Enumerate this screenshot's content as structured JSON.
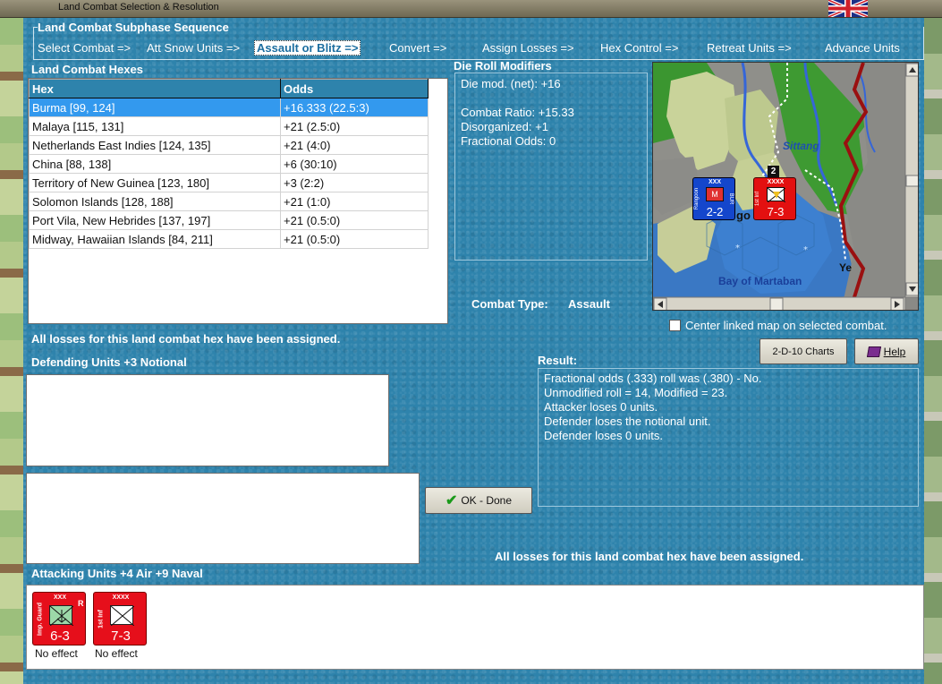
{
  "window": {
    "title": "Land Combat Selection & Resolution"
  },
  "sequence": {
    "title": "Land Combat Subphase Sequence",
    "steps": [
      "Select Combat =>",
      "Att Snow Units =>",
      "Assault or Blitz =>",
      "Convert =>",
      "Assign Losses =>",
      "Hex Control =>",
      "Retreat Units =>",
      "Advance Units"
    ],
    "active_index": 2
  },
  "hexes": {
    "title": "Land Combat Hexes",
    "columns": [
      "Hex",
      "Odds"
    ],
    "rows": [
      {
        "hex": "Burma [99, 124]",
        "odds": "+16.333 (22.5:3)"
      },
      {
        "hex": "Malaya [115, 131]",
        "odds": "+21 (2.5:0)"
      },
      {
        "hex": "Netherlands East Indies [124, 135]",
        "odds": "+21 (4:0)"
      },
      {
        "hex": "China [88, 138]",
        "odds": "+6 (30:10)"
      },
      {
        "hex": "Territory of New Guinea [123, 180]",
        "odds": "+3 (2:2)"
      },
      {
        "hex": "Solomon Islands [128, 188]",
        "odds": "+21 (1:0)"
      },
      {
        "hex": "Port Vila, New Hebrides [137, 197]",
        "odds": "+21 (0.5:0)"
      },
      {
        "hex": "Midway, Hawaiian Islands [84, 211]",
        "odds": "+21 (0.5:0)"
      }
    ],
    "selected_index": 0
  },
  "drm": {
    "title": "Die Roll Modifiers",
    "lines": [
      "Die mod. (net): +16",
      "",
      "Combat Ratio: +15.33",
      "Disorganized: +1",
      "Fractional Odds: 0"
    ]
  },
  "map": {
    "labels": {
      "sittang": "Sittang",
      "bay": "Bay of Martaban",
      "ye": "Ye",
      "go": "go"
    },
    "units": [
      {
        "corp": "XXX",
        "name": "Rangoon",
        "nation": "BUR",
        "strength": "2-2",
        "color": "#1040d0"
      },
      {
        "corp": "XXXX",
        "name": "1st Inf",
        "strength": "7-3",
        "color": "#e01010"
      }
    ],
    "stack_count": "2"
  },
  "combat_type": {
    "label": "Combat Type:",
    "value": "Assault"
  },
  "center_link": {
    "label": "Center linked map on selected combat.",
    "checked": false
  },
  "buttons": {
    "charts": "2-D-10 Charts",
    "help": "Help",
    "ok": "OK - Done"
  },
  "messages": {
    "losses_top": "All losses for this land combat hex have been assigned.",
    "losses_bottom": "All losses for this land combat hex have been assigned."
  },
  "defending": {
    "title": "Defending Units +3 Notional"
  },
  "result": {
    "title": "Result:",
    "lines": [
      "Fractional odds (.333) roll was (.380)  - No.",
      "Unmodified roll = 14, Modified = 23.",
      "Attacker loses 0 units.",
      "Defender loses the notional unit.",
      "Defender loses 0 units."
    ]
  },
  "attacking": {
    "title": "Attacking Units +4 Air +9 Naval",
    "units": [
      {
        "corp": "XXX",
        "name": "Imp. Guard",
        "strength": "6-3",
        "flag": "R",
        "status": "No effect",
        "sym_color": "#9cd8a8"
      },
      {
        "corp": "XXXX",
        "name": "1st Inf",
        "strength": "7-3",
        "flag": "",
        "status": "No effect",
        "sym_color": "#ffffff"
      }
    ]
  }
}
